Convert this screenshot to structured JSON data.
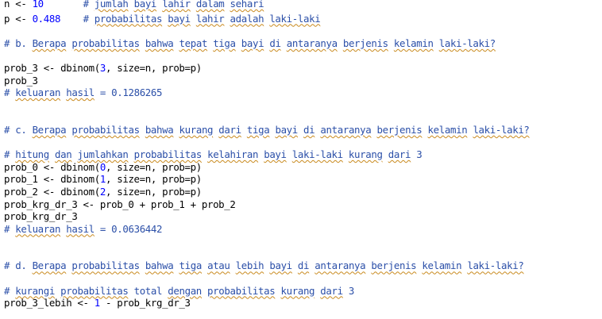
{
  "editor": {
    "lines": [
      [
        {
          "t": "n <- ",
          "c": "plain"
        },
        {
          "t": "10",
          "c": "num"
        },
        {
          "t": "       # ",
          "c": "comment-blue"
        },
        {
          "t": "jumlah",
          "c": "comment-blue",
          "sq": true
        },
        {
          "t": " ",
          "c": "comment-blue"
        },
        {
          "t": "bayi",
          "c": "comment-blue",
          "sq": true
        },
        {
          "t": " ",
          "c": "comment-blue"
        },
        {
          "t": "lahir",
          "c": "comment-blue",
          "sq": true
        },
        {
          "t": " ",
          "c": "comment-blue"
        },
        {
          "t": "dalam",
          "c": "comment-blue",
          "sq": true
        },
        {
          "t": " ",
          "c": "comment-blue"
        },
        {
          "t": "sehari",
          "c": "comment-blue",
          "sq": true
        }
      ],
      [
        {
          "t": "p <- ",
          "c": "plain"
        },
        {
          "t": "0.488",
          "c": "num"
        },
        {
          "t": "    # ",
          "c": "comment-blue"
        },
        {
          "t": "probabilitas",
          "c": "comment-blue",
          "sq": true
        },
        {
          "t": " ",
          "c": "comment-blue"
        },
        {
          "t": "bayi",
          "c": "comment-blue",
          "sq": true
        },
        {
          "t": " ",
          "c": "comment-blue"
        },
        {
          "t": "lahir",
          "c": "comment-blue",
          "sq": true
        },
        {
          "t": " ",
          "c": "comment-blue"
        },
        {
          "t": "adalah",
          "c": "comment-blue",
          "sq": true
        },
        {
          "t": " ",
          "c": "comment-blue"
        },
        {
          "t": "laki-laki",
          "c": "comment-blue",
          "sq": true
        }
      ],
      [],
      [
        {
          "t": "# b. ",
          "c": "comment-blue"
        },
        {
          "t": "Berapa",
          "c": "comment-blue",
          "sq": true
        },
        {
          "t": " ",
          "c": "comment-blue"
        },
        {
          "t": "probabilitas",
          "c": "comment-blue",
          "sq": true
        },
        {
          "t": " ",
          "c": "comment-blue"
        },
        {
          "t": "bahwa",
          "c": "comment-blue",
          "sq": true
        },
        {
          "t": " ",
          "c": "comment-blue"
        },
        {
          "t": "tepat",
          "c": "comment-blue",
          "sq": true
        },
        {
          "t": " ",
          "c": "comment-blue"
        },
        {
          "t": "tiga",
          "c": "comment-blue",
          "sq": true
        },
        {
          "t": " ",
          "c": "comment-blue"
        },
        {
          "t": "bayi",
          "c": "comment-blue",
          "sq": true
        },
        {
          "t": " ",
          "c": "comment-blue"
        },
        {
          "t": "di",
          "c": "comment-blue",
          "sq": true
        },
        {
          "t": " ",
          "c": "comment-blue"
        },
        {
          "t": "antaranya",
          "c": "comment-blue",
          "sq": true
        },
        {
          "t": " ",
          "c": "comment-blue"
        },
        {
          "t": "berjenis",
          "c": "comment-blue",
          "sq": true
        },
        {
          "t": " ",
          "c": "comment-blue"
        },
        {
          "t": "kelamin",
          "c": "comment-blue",
          "sq": true
        },
        {
          "t": " ",
          "c": "comment-blue"
        },
        {
          "t": "laki-laki?",
          "c": "comment-blue",
          "sq": true
        }
      ],
      [],
      [
        {
          "t": "prob_3 <- dbinom(",
          "c": "plain"
        },
        {
          "t": "3",
          "c": "num"
        },
        {
          "t": ", size=n, prob=p)",
          "c": "plain"
        }
      ],
      [
        {
          "t": "prob_3",
          "c": "plain"
        }
      ],
      [
        {
          "t": "# ",
          "c": "comment-blue"
        },
        {
          "t": "keluaran",
          "c": "comment-blue",
          "sq": true
        },
        {
          "t": " ",
          "c": "comment-blue"
        },
        {
          "t": "hasil",
          "c": "comment-blue",
          "sq": true
        },
        {
          "t": " = 0.1286265",
          "c": "comment-blue"
        }
      ],
      [],
      [],
      [
        {
          "t": "# c. ",
          "c": "comment-blue"
        },
        {
          "t": "Berapa",
          "c": "comment-blue",
          "sq": true
        },
        {
          "t": " ",
          "c": "comment-blue"
        },
        {
          "t": "probabilitas",
          "c": "comment-blue",
          "sq": true
        },
        {
          "t": " ",
          "c": "comment-blue"
        },
        {
          "t": "bahwa",
          "c": "comment-blue",
          "sq": true
        },
        {
          "t": " ",
          "c": "comment-blue"
        },
        {
          "t": "kurang",
          "c": "comment-blue",
          "sq": true
        },
        {
          "t": " ",
          "c": "comment-blue"
        },
        {
          "t": "dari",
          "c": "comment-blue",
          "sq": true
        },
        {
          "t": " ",
          "c": "comment-blue"
        },
        {
          "t": "tiga",
          "c": "comment-blue",
          "sq": true
        },
        {
          "t": " ",
          "c": "comment-blue"
        },
        {
          "t": "bayi",
          "c": "comment-blue",
          "sq": true
        },
        {
          "t": " ",
          "c": "comment-blue"
        },
        {
          "t": "di",
          "c": "comment-blue",
          "sq": true
        },
        {
          "t": " ",
          "c": "comment-blue"
        },
        {
          "t": "antaranya",
          "c": "comment-blue",
          "sq": true
        },
        {
          "t": " ",
          "c": "comment-blue"
        },
        {
          "t": "berjenis",
          "c": "comment-blue",
          "sq": true
        },
        {
          "t": " ",
          "c": "comment-blue"
        },
        {
          "t": "kelamin",
          "c": "comment-blue",
          "sq": true
        },
        {
          "t": " ",
          "c": "comment-blue"
        },
        {
          "t": "laki-laki?",
          "c": "comment-blue",
          "sq": true
        }
      ],
      [],
      [
        {
          "t": "# ",
          "c": "comment-blue"
        },
        {
          "t": "hitung",
          "c": "comment-blue",
          "sq": true
        },
        {
          "t": " ",
          "c": "comment-blue"
        },
        {
          "t": "dan",
          "c": "comment-blue",
          "sq": true
        },
        {
          "t": " ",
          "c": "comment-blue"
        },
        {
          "t": "jumlahkan",
          "c": "comment-blue",
          "sq": true
        },
        {
          "t": " ",
          "c": "comment-blue"
        },
        {
          "t": "probabilitas",
          "c": "comment-blue",
          "sq": true
        },
        {
          "t": " ",
          "c": "comment-blue"
        },
        {
          "t": "kelahiran",
          "c": "comment-blue",
          "sq": true
        },
        {
          "t": " ",
          "c": "comment-blue"
        },
        {
          "t": "bayi",
          "c": "comment-blue",
          "sq": true
        },
        {
          "t": " ",
          "c": "comment-blue"
        },
        {
          "t": "laki-laki",
          "c": "comment-blue",
          "sq": true
        },
        {
          "t": " ",
          "c": "comment-blue"
        },
        {
          "t": "kurang",
          "c": "comment-blue",
          "sq": true
        },
        {
          "t": " ",
          "c": "comment-blue"
        },
        {
          "t": "dari",
          "c": "comment-blue",
          "sq": true
        },
        {
          "t": " 3",
          "c": "comment-blue"
        }
      ],
      [
        {
          "t": "prob_0 <- dbinom(",
          "c": "plain"
        },
        {
          "t": "0",
          "c": "num"
        },
        {
          "t": ", size=n, prob=p)",
          "c": "plain"
        }
      ],
      [
        {
          "t": "prob_1 <- dbinom(",
          "c": "plain"
        },
        {
          "t": "1",
          "c": "num"
        },
        {
          "t": ", size=n, prob=p)",
          "c": "plain"
        }
      ],
      [
        {
          "t": "prob_2 <- dbinom(",
          "c": "plain"
        },
        {
          "t": "2",
          "c": "num"
        },
        {
          "t": ", size=n, prob=p)",
          "c": "plain"
        }
      ],
      [
        {
          "t": "prob_krg_dr_3 <- prob_0 + prob_1 + prob_2",
          "c": "plain"
        }
      ],
      [
        {
          "t": "prob_krg_dr_3",
          "c": "plain"
        }
      ],
      [
        {
          "t": "# ",
          "c": "comment-blue"
        },
        {
          "t": "keluaran",
          "c": "comment-blue",
          "sq": true
        },
        {
          "t": " ",
          "c": "comment-blue"
        },
        {
          "t": "hasil",
          "c": "comment-blue",
          "sq": true
        },
        {
          "t": " = 0.0636442",
          "c": "comment-blue"
        }
      ],
      [],
      [],
      [
        {
          "t": "# d. ",
          "c": "comment-blue"
        },
        {
          "t": "Berapa",
          "c": "comment-blue",
          "sq": true
        },
        {
          "t": " ",
          "c": "comment-blue"
        },
        {
          "t": "probabilitas",
          "c": "comment-blue",
          "sq": true
        },
        {
          "t": " ",
          "c": "comment-blue"
        },
        {
          "t": "bahwa",
          "c": "comment-blue",
          "sq": true
        },
        {
          "t": " ",
          "c": "comment-blue"
        },
        {
          "t": "tiga",
          "c": "comment-blue",
          "sq": true
        },
        {
          "t": " ",
          "c": "comment-blue"
        },
        {
          "t": "atau",
          "c": "comment-blue",
          "sq": true
        },
        {
          "t": " ",
          "c": "comment-blue"
        },
        {
          "t": "lebih",
          "c": "comment-blue",
          "sq": true
        },
        {
          "t": " ",
          "c": "comment-blue"
        },
        {
          "t": "bayi",
          "c": "comment-blue",
          "sq": true
        },
        {
          "t": " ",
          "c": "comment-blue"
        },
        {
          "t": "di",
          "c": "comment-blue",
          "sq": true
        },
        {
          "t": " ",
          "c": "comment-blue"
        },
        {
          "t": "antaranya",
          "c": "comment-blue",
          "sq": true
        },
        {
          "t": " ",
          "c": "comment-blue"
        },
        {
          "t": "berjenis",
          "c": "comment-blue",
          "sq": true
        },
        {
          "t": " ",
          "c": "comment-blue"
        },
        {
          "t": "kelamin",
          "c": "comment-blue",
          "sq": true
        },
        {
          "t": " ",
          "c": "comment-blue"
        },
        {
          "t": "laki-laki?",
          "c": "comment-blue",
          "sq": true
        }
      ],
      [],
      [
        {
          "t": "# ",
          "c": "comment-blue"
        },
        {
          "t": "kurangi",
          "c": "comment-blue",
          "sq": true
        },
        {
          "t": " ",
          "c": "comment-blue"
        },
        {
          "t": "probabilitas",
          "c": "comment-blue",
          "sq": true
        },
        {
          "t": " total ",
          "c": "comment-blue"
        },
        {
          "t": "dengan",
          "c": "comment-blue",
          "sq": true
        },
        {
          "t": " ",
          "c": "comment-blue"
        },
        {
          "t": "probabilitas",
          "c": "comment-blue",
          "sq": true
        },
        {
          "t": " ",
          "c": "comment-blue"
        },
        {
          "t": "kurang",
          "c": "comment-blue",
          "sq": true
        },
        {
          "t": " ",
          "c": "comment-blue"
        },
        {
          "t": "dari",
          "c": "comment-blue",
          "sq": true
        },
        {
          "t": " 3",
          "c": "comment-blue"
        }
      ],
      [
        {
          "t": "prob_3_lebih <- ",
          "c": "plain"
        },
        {
          "t": "1",
          "c": "num"
        },
        {
          "t": " - prob_krg_dr_3",
          "c": "plain"
        }
      ]
    ]
  }
}
